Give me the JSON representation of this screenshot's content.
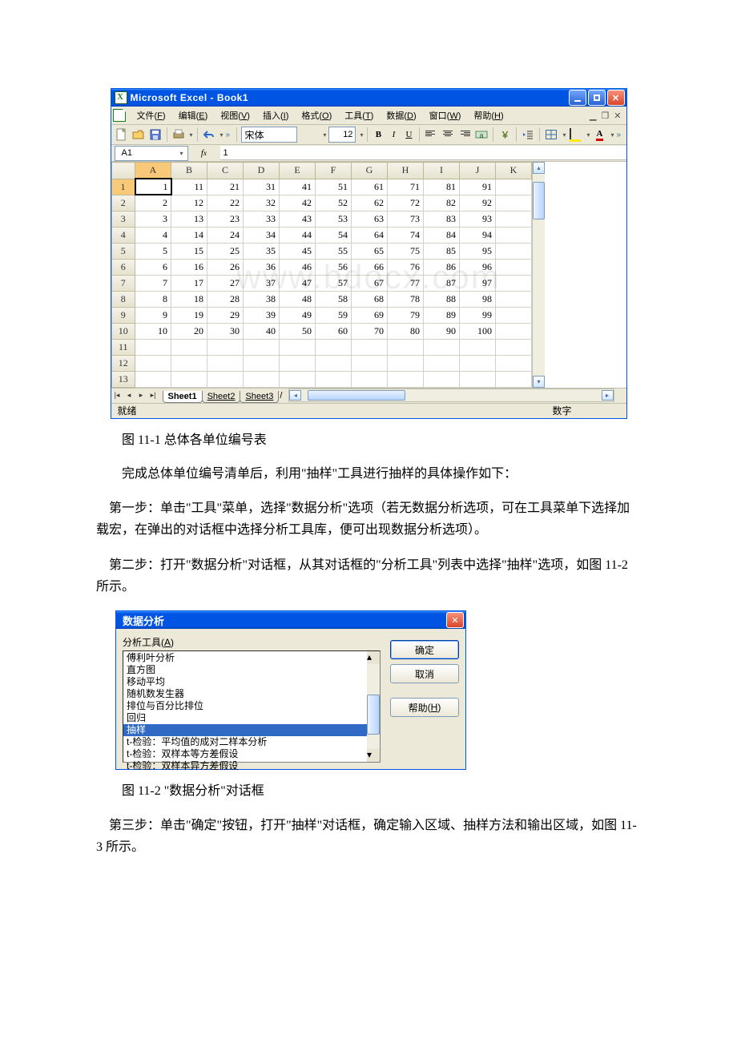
{
  "excel": {
    "title": "Microsoft Excel - Book1",
    "menus": [
      {
        "label": "文件",
        "mnem": "F"
      },
      {
        "label": "编辑",
        "mnem": "E"
      },
      {
        "label": "视图",
        "mnem": "V"
      },
      {
        "label": "插入",
        "mnem": "I"
      },
      {
        "label": "格式",
        "mnem": "O"
      },
      {
        "label": "工具",
        "mnem": "T"
      },
      {
        "label": "数据",
        "mnem": "D"
      },
      {
        "label": "窗口",
        "mnem": "W"
      },
      {
        "label": "帮助",
        "mnem": "H"
      }
    ],
    "font_name": "宋体",
    "font_size": "12",
    "namebox": "A1",
    "formula_value": "1",
    "columns": [
      "A",
      "B",
      "C",
      "D",
      "E",
      "F",
      "G",
      "H",
      "I",
      "J",
      "K"
    ],
    "row_count": 13,
    "chart_data": {
      "type": "table",
      "columns": [
        "A",
        "B",
        "C",
        "D",
        "E",
        "F",
        "G",
        "H",
        "I",
        "J"
      ],
      "rows": [
        [
          1,
          11,
          21,
          31,
          41,
          51,
          61,
          71,
          81,
          91
        ],
        [
          2,
          12,
          22,
          32,
          42,
          52,
          62,
          72,
          82,
          92
        ],
        [
          3,
          13,
          23,
          33,
          43,
          53,
          63,
          73,
          83,
          93
        ],
        [
          4,
          14,
          24,
          34,
          44,
          54,
          64,
          74,
          84,
          94
        ],
        [
          5,
          15,
          25,
          35,
          45,
          55,
          65,
          75,
          85,
          95
        ],
        [
          6,
          16,
          26,
          36,
          46,
          56,
          66,
          76,
          86,
          96
        ],
        [
          7,
          17,
          27,
          37,
          47,
          57,
          67,
          77,
          87,
          97
        ],
        [
          8,
          18,
          28,
          38,
          48,
          58,
          68,
          78,
          88,
          98
        ],
        [
          9,
          19,
          29,
          39,
          49,
          59,
          69,
          79,
          89,
          99
        ],
        [
          10,
          20,
          30,
          40,
          50,
          60,
          70,
          80,
          90,
          100
        ]
      ]
    },
    "tabs": [
      "Sheet1",
      "Sheet2",
      "Sheet3"
    ],
    "active_tab": 0,
    "status_left": "就绪",
    "status_right": "数字"
  },
  "text": {
    "caption1": "图 11-1 总体各单位编号表",
    "para1": "完成总体单位编号清单后，利用\"抽样\"工具进行抽样的具体操作如下：",
    "para2": "　第一步：单击\"工具\"菜单，选择\"数据分析\"选项（若无数据分析选项，可在工具菜单下选择加载宏，在弹出的对话框中选择分析工具库，便可出现数据分析选项）。",
    "para3": "　第二步：打开\"数据分析\"对话框，从其对话框的\"分析工具\"列表中选择\"抽样\"选项，如图 11-2 所示。",
    "caption2": "图 11-2 \"数据分析\"对话框",
    "para4": "　第三步：单击\"确定\"按钮，打开\"抽样\"对话框，确定输入区域、抽样方法和输出区域，如图 11-3 所示。",
    "watermark": "www.bdocx.com"
  },
  "dialog": {
    "title": "数据分析",
    "list_label": "分析工具",
    "list_mnem": "A",
    "items": [
      "傅利叶分析",
      "直方图",
      "移动平均",
      "随机数发生器",
      "排位与百分比排位",
      "回归",
      "抽样",
      "t-检验：平均值的成对二样本分析",
      "t-检验：双样本等方差假设",
      "t-检验：双样本异方差假设"
    ],
    "selected_index": 6,
    "buttons": {
      "ok": "确定",
      "cancel": "取消",
      "help_label": "帮助",
      "help_mnem": "H"
    }
  }
}
